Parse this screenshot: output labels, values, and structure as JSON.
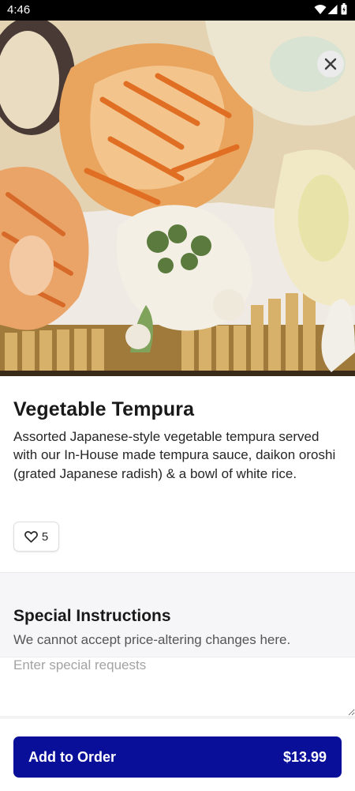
{
  "status_bar": {
    "time": "4:46",
    "icons": [
      "wifi-icon",
      "signal-icon",
      "battery-icon"
    ]
  },
  "hero": {
    "image": "tempura-photo",
    "close_icon": "close-icon"
  },
  "item": {
    "title": "Vegetable Tempura",
    "description": "Assorted Japanese-style vegetable tempura served with our In-House made tempura sauce, daikon oroshi (grated Japanese radish) & a bowl of white rice.",
    "likes": "5",
    "like_icon": "heart-icon"
  },
  "special_instructions": {
    "title": "Special Instructions",
    "subtitle": "We cannot accept price-altering changes here.",
    "placeholder": "Enter special requests",
    "value": ""
  },
  "order": {
    "add_label": "Add to Order",
    "price": "$13.99"
  },
  "colors": {
    "primary_button": "#0a0f99",
    "section_background": "#f6f6f8",
    "status_bar": "#000000"
  }
}
